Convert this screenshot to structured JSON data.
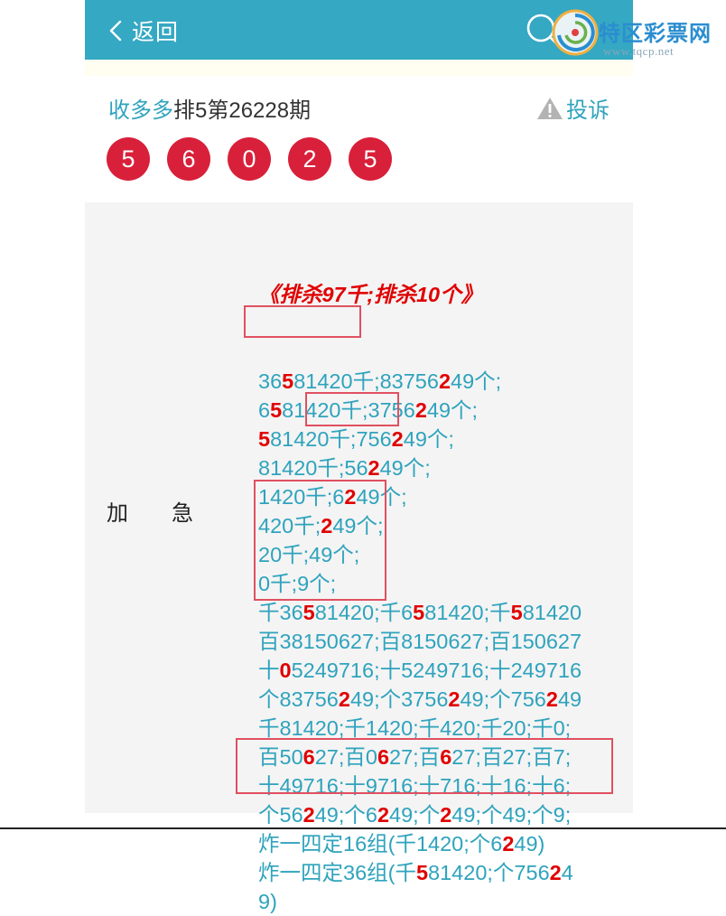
{
  "header": {
    "back_label": "返回",
    "watermark_title": "特区彩票网",
    "watermark_url": "www.tqcp.net"
  },
  "issue": {
    "site": "收多多",
    "title": "排5第26228期",
    "complain_label": "投诉"
  },
  "balls": [
    "5",
    "6",
    "0",
    "2",
    "5"
  ],
  "panel": {
    "label": [
      "加",
      "急"
    ],
    "heading": "《排杀97千;排杀10个》",
    "lines": [
      [
        {
          "t": "36"
        },
        {
          "t": "5",
          "h": true
        },
        {
          "t": "81420千;83756"
        },
        {
          "t": "2",
          "h": true
        },
        {
          "t": "49个;"
        }
      ],
      [
        {
          "t": "6"
        },
        {
          "t": "5",
          "h": true
        },
        {
          "t": "81420千;3756"
        },
        {
          "t": "2",
          "h": true
        },
        {
          "t": "49个;"
        }
      ],
      [
        {
          "t": "5",
          "h": true
        },
        {
          "t": "81420千;756"
        },
        {
          "t": "2",
          "h": true
        },
        {
          "t": "49个;"
        }
      ],
      [
        {
          "t": "81420千;56"
        },
        {
          "t": "2",
          "h": true
        },
        {
          "t": "49个;"
        }
      ],
      [
        {
          "t": "1420千;6"
        },
        {
          "t": "2",
          "h": true
        },
        {
          "t": "49个;"
        }
      ],
      [
        {
          "t": "420千;"
        },
        {
          "t": "2",
          "h": true
        },
        {
          "t": "49个;"
        }
      ],
      [
        {
          "t": "20千;49个;"
        }
      ],
      [
        {
          "t": "0千;9个;"
        }
      ],
      [
        {
          "t": "千36"
        },
        {
          "t": "5",
          "h": true
        },
        {
          "t": "81420;千6"
        },
        {
          "t": "5",
          "h": true
        },
        {
          "t": "81420;千"
        },
        {
          "t": "5",
          "h": true
        },
        {
          "t": "81420"
        }
      ],
      [
        {
          "t": "百381506"
        },
        {
          "t": "2",
          "h": false
        },
        {
          "t": "7;百81506"
        },
        {
          "t": "2",
          "h": false
        },
        {
          "t": "7;百1506"
        },
        {
          "t": "2",
          "h": false
        },
        {
          "t": "7"
        }
      ],
      [
        {
          "t": "十"
        },
        {
          "t": "0",
          "h": true
        },
        {
          "t": "5249716;十5249716;十249716"
        }
      ],
      [
        {
          "t": "个83756"
        },
        {
          "t": "2",
          "h": true
        },
        {
          "t": "49;个3756"
        },
        {
          "t": "2",
          "h": true
        },
        {
          "t": "49;个756"
        },
        {
          "t": "2",
          "h": true
        },
        {
          "t": "49"
        }
      ],
      [
        {
          "t": "千81420;千1420;千420;千20;千0;"
        }
      ],
      [
        {
          "t": "百50"
        },
        {
          "t": "6",
          "h": true
        },
        {
          "t": "27;百0"
        },
        {
          "t": "6",
          "h": true
        },
        {
          "t": "27;百"
        },
        {
          "t": "6",
          "h": true
        },
        {
          "t": "27;百27;百7;"
        }
      ],
      [
        {
          "t": "十49716;十9716;十716;十16;十6;"
        }
      ],
      [
        {
          "t": "个56"
        },
        {
          "t": "2",
          "h": true
        },
        {
          "t": "49;个6"
        },
        {
          "t": "2",
          "h": true
        },
        {
          "t": "49;个"
        },
        {
          "t": "2",
          "h": true
        },
        {
          "t": "49;个49;个9;"
        }
      ],
      [
        {
          "t": "炸一四定16组(千1420;个6"
        },
        {
          "t": "2",
          "h": true
        },
        {
          "t": "49)"
        }
      ],
      [
        {
          "t": "炸一四定36组(千"
        },
        {
          "t": "5",
          "h": true
        },
        {
          "t": "81420;个756"
        },
        {
          "t": "2",
          "h": true
        },
        {
          "t": "4"
        }
      ],
      [
        {
          "t": "9)"
        }
      ]
    ]
  }
}
